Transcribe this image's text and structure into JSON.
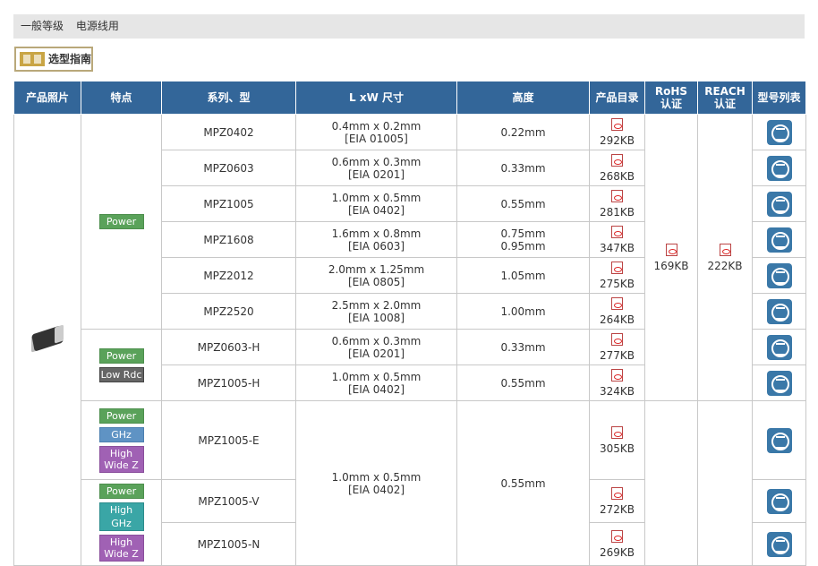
{
  "breadcrumb": {
    "primary": "一般等级",
    "secondary": "电源线用"
  },
  "guide_button": {
    "label": "选型指南"
  },
  "table": {
    "headers": [
      "产品照片",
      "特点",
      "系列、型",
      "L xW 尺寸",
      "高度",
      "产品目录",
      "RoHS\n认证",
      "REACH\n认证",
      "型号列表"
    ],
    "rohs_kb": "169KB",
    "reach_kb": "222KB",
    "rows": [
      {
        "series": "MPZ0402",
        "size1": "0.4mm x 0.2mm",
        "size2": "[EIA 01005]",
        "height": "0.22mm",
        "kb": "292KB"
      },
      {
        "series": "MPZ0603",
        "size1": "0.6mm x 0.3mm",
        "size2": "[EIA 0201]",
        "height": "0.33mm",
        "kb": "268KB"
      },
      {
        "series": "MPZ1005",
        "size1": "1.0mm x 0.5mm",
        "size2": "[EIA 0402]",
        "height": "0.55mm",
        "kb": "281KB"
      },
      {
        "series": "MPZ1608",
        "size1": "1.6mm x 0.8mm",
        "size2": "[EIA 0603]",
        "height": "0.75mm",
        "height2": "0.95mm",
        "kb": "347KB"
      },
      {
        "series": "MPZ2012",
        "size1": "2.0mm x 1.25mm",
        "size2": "[EIA 0805]",
        "height": "1.05mm",
        "kb": "275KB"
      },
      {
        "series": "MPZ2520",
        "size1": "2.5mm x 2.0mm",
        "size2": "[EIA 1008]",
        "height": "1.00mm",
        "kb": "264KB"
      },
      {
        "series": "MPZ0603-H",
        "size1": "0.6mm x 0.3mm",
        "size2": "[EIA 0201]",
        "height": "0.33mm",
        "kb": "277KB"
      },
      {
        "series": "MPZ1005-H",
        "size1": "1.0mm x 0.5mm",
        "size2": "[EIA 0402]",
        "height": "0.55mm",
        "kb": "324KB"
      },
      {
        "series": "MPZ1005-E",
        "kb": "305KB"
      },
      {
        "series": "MPZ1005-V",
        "kb": "272KB"
      },
      {
        "series": "MPZ1005-N",
        "kb": "269KB"
      }
    ],
    "merged_size1": "1.0mm x 0.5mm",
    "merged_size2": "[EIA 0402]",
    "merged_height": "0.55mm",
    "badges": {
      "power": "Power",
      "low_rdc": "Low Rdc",
      "ghz": "GHz",
      "high_wide_z_1": "High",
      "high_wide_z_2": "Wide Z",
      "high_ghz": "High GHz"
    }
  }
}
